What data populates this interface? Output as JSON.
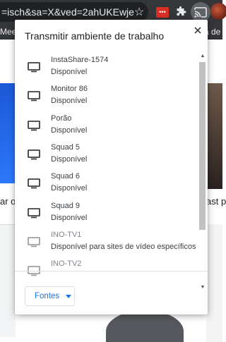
{
  "browser": {
    "url_fragment": "=isch&sa=X&ved=2ahUKEwje",
    "extension_badge": "•••",
    "bookmark_left": "Mee",
    "bookmark_right": "a de"
  },
  "page": {
    "left_snippet": "ar o C",
    "right_snippet": "ast p"
  },
  "dialog": {
    "title": "Transmitir ambiente de trabalho",
    "close_icon": "close-icon",
    "sinks": [
      {
        "name": "InstaShare-1574",
        "status": "Disponível",
        "icon": "monitor-icon",
        "enabled": true
      },
      {
        "name": "Monitor 86",
        "status": "Disponível",
        "icon": "monitor-icon",
        "enabled": true
      },
      {
        "name": "Porão",
        "status": "Disponível",
        "icon": "monitor-icon",
        "enabled": true
      },
      {
        "name": "Squad 5",
        "status": "Disponível",
        "icon": "monitor-icon",
        "enabled": true
      },
      {
        "name": "Squad 6",
        "status": "Disponível",
        "icon": "monitor-icon",
        "enabled": true
      },
      {
        "name": "Squad 9",
        "status": "Disponível",
        "icon": "monitor-icon",
        "enabled": true
      },
      {
        "name": "INO-TV1",
        "status": "Disponível para sites de vídeo específicos",
        "icon": "monitor-icon",
        "enabled": false
      },
      {
        "name": "INO-TV2",
        "status": "",
        "icon": "monitor-icon",
        "enabled": false
      }
    ],
    "sources_button": "Fontes"
  },
  "colors": {
    "accent": "#1a73e8",
    "toolbar": "#35363a",
    "omnibox": "#202124"
  }
}
